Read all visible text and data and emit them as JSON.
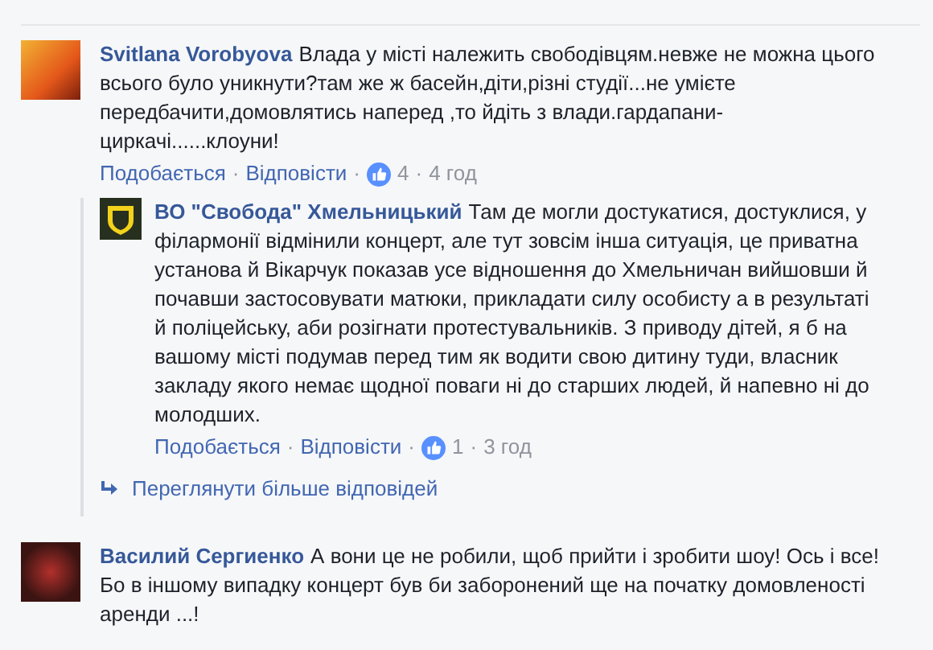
{
  "comments": [
    {
      "author": "Svitlana Vorobyova",
      "text": "Влада у місті належить свободівцям.невже не можна цього всього було уникнути?там же ж басейн,діти,різні студії...не умієте передбачити,домовлятись наперед ,то йдіть з влади.гардапани-циркачі......клоуни!",
      "kind": "user",
      "actions": {
        "like": "Подобається",
        "separator": "·",
        "reply": "Відповісти",
        "likes": "4",
        "time": "4 год"
      },
      "replies": [
        {
          "author": "ВО \"Свобода\" Хмельницький",
          "text": "Там де могли достукатися, достуклися, у філармонії відмінили концерт, але тут зовсім інша ситуація, це приватна установа й Вікарчук показав усе відношення до Хмельничан вийшовши й почавши застосовувати матюки, прикладати силу особисту а в результаті й поліцейську, аби розігнати протестувальників. З приводу дітей, я б на вашому місті подумав перед тим як водити свою дитину туди, власник закладу якого немає щодної поваги ні до старших людей, й напевно ні до молодших.",
          "kind": "page",
          "actions": {
            "like": "Подобається",
            "separator": "·",
            "reply": "Відповісти",
            "likes": "1",
            "time": "3 год"
          }
        }
      ],
      "more_replies": "Переглянути більше відповідей"
    },
    {
      "author": "Василий Сергиенко",
      "text": "А вони це не робили, щоб прийти і зробити шоу! Ось і все! Бо в іншому випадку концерт був би заборонений ще на початку домовленості аренди ...!",
      "kind": "user"
    }
  ]
}
